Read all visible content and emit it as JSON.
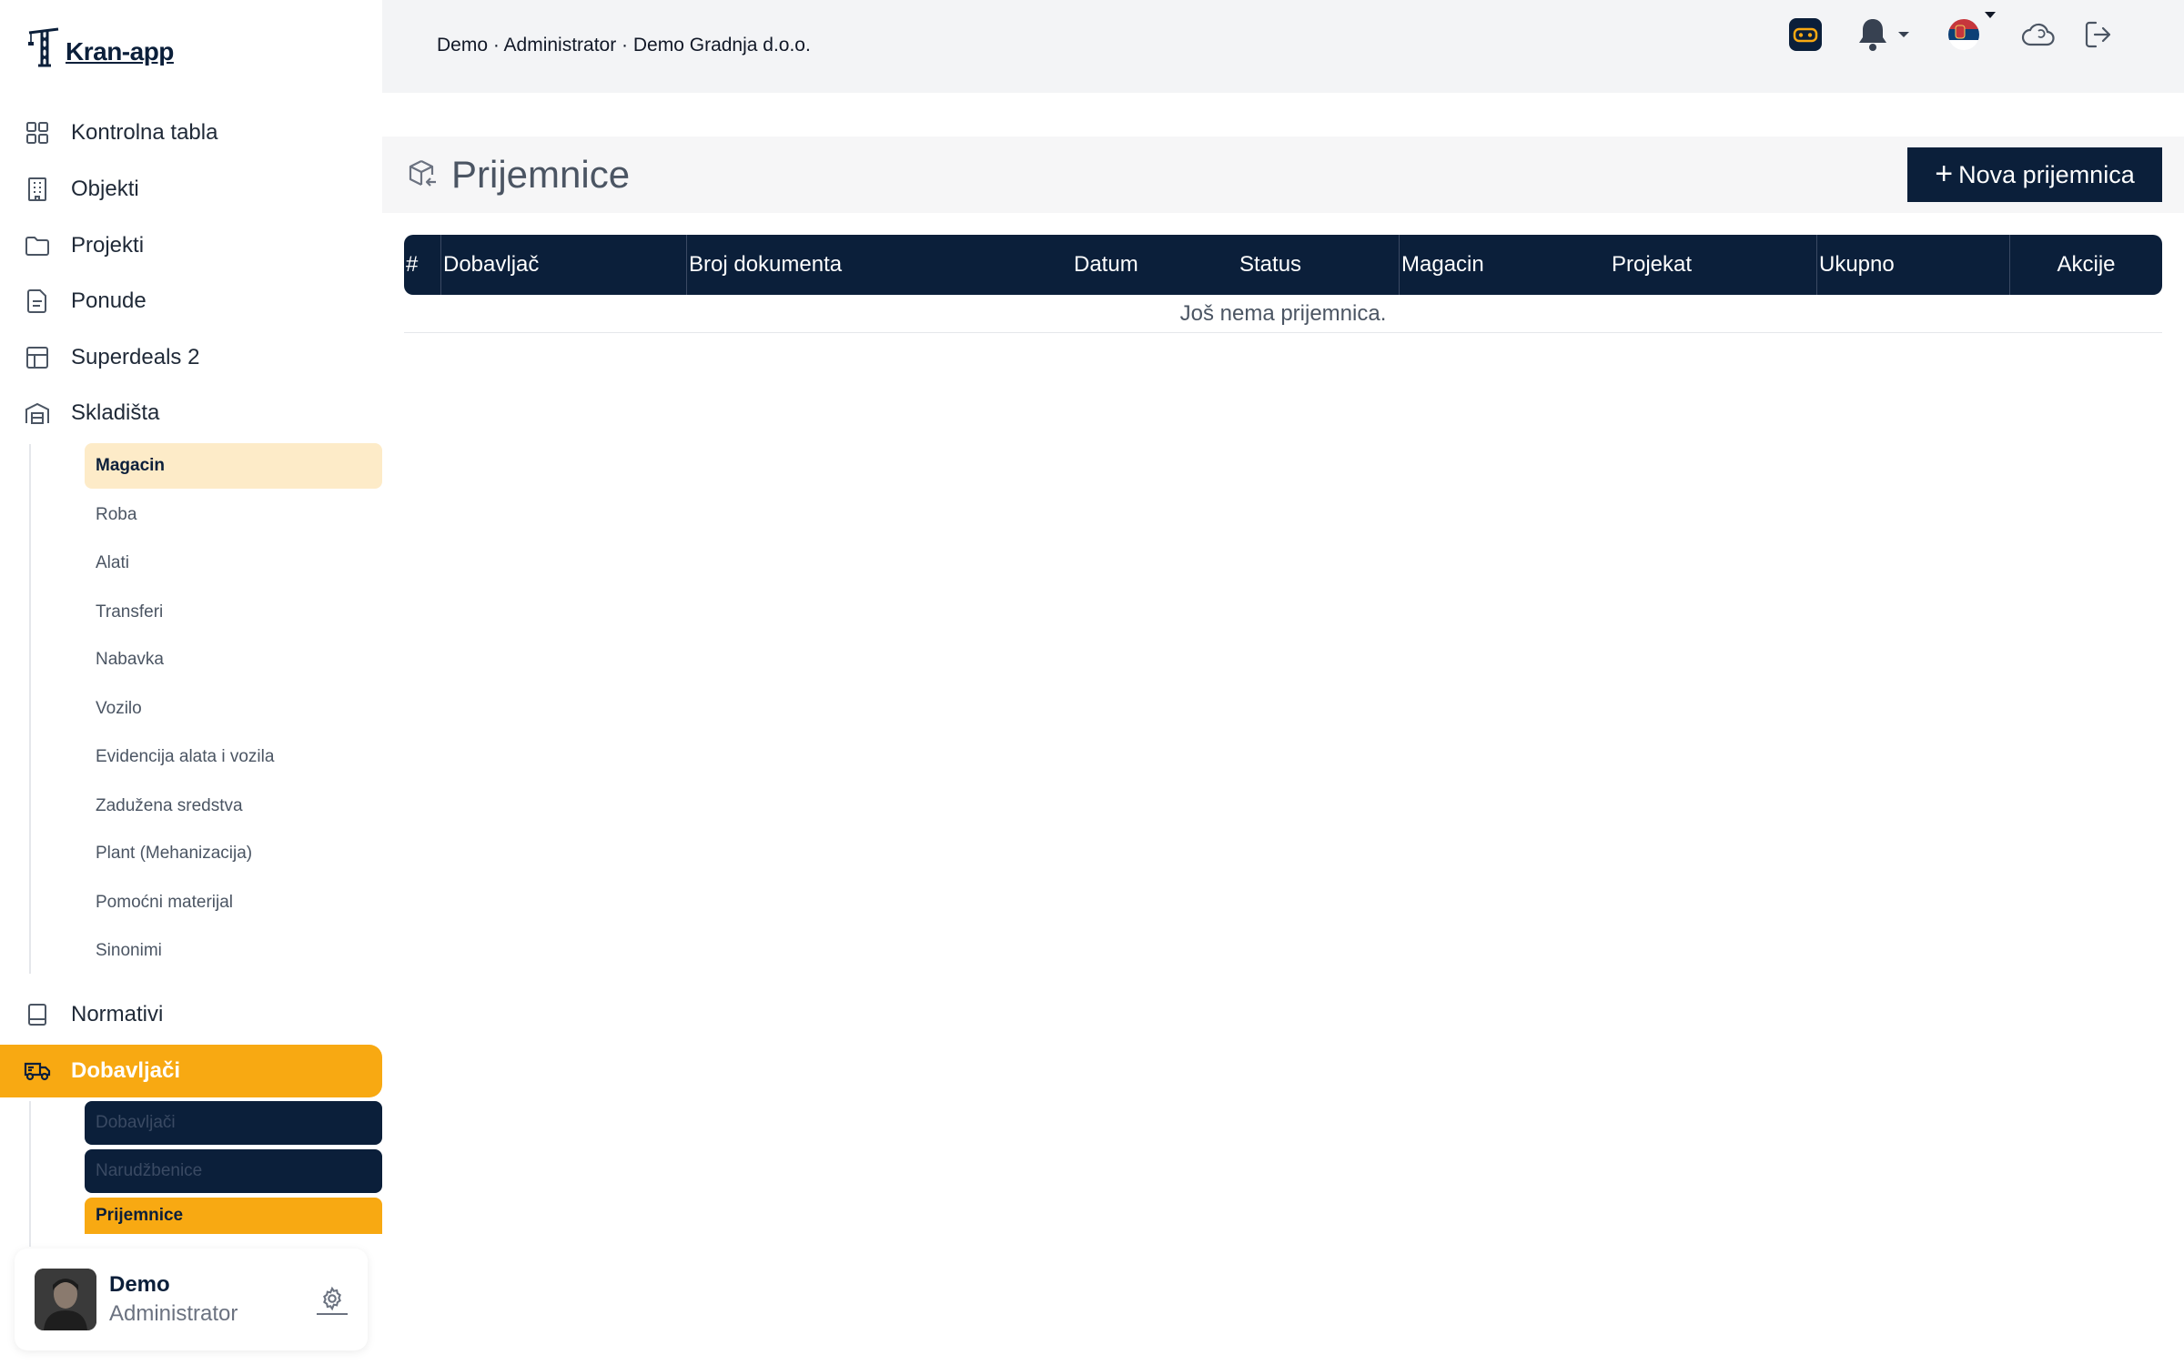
{
  "app": {
    "logo_text": "Kran-app"
  },
  "sidebar": {
    "nav": [
      {
        "label": "Kontrolna tabla",
        "icon": "dashboard-grid-icon"
      },
      {
        "label": "Objekti",
        "icon": "building-icon"
      },
      {
        "label": "Projekti",
        "icon": "folder-icon"
      },
      {
        "label": "Ponude",
        "icon": "document-icon"
      },
      {
        "label": "Superdeals 2",
        "icon": "table-icon"
      },
      {
        "label": "Skladišta",
        "icon": "warehouse-icon"
      }
    ],
    "skladista_sub": [
      "Magacin",
      "Roba",
      "Alati",
      "Transferi",
      "Nabavka",
      "Vozilo",
      "Evidencija alata i vozila",
      "Zadužena sredstva",
      "Plant (Mehanizacija)",
      "Pomoćni materijal",
      "Sinonimi"
    ],
    "nav2": [
      {
        "label": "Normativi",
        "icon": "book-icon"
      },
      {
        "label": "Dobavljači",
        "icon": "truck-icon"
      }
    ],
    "dobavljaci_sub": [
      "Dobavljači",
      "Narudžbenice",
      "Prijemnice"
    ],
    "active_color": "#f8a912"
  },
  "topbar": {
    "breadcrumb": "Demo · Administrator · Demo Gradnja d.o.o."
  },
  "page": {
    "title": "Prijemnice",
    "new_button": "Nova prijemnica",
    "plus": "+"
  },
  "table": {
    "columns": [
      "#",
      "Dobavljač",
      "Broj dokumenta",
      "Datum",
      "Status",
      "Magacin",
      "Projekat",
      "Ukupno",
      "Akcije"
    ],
    "empty_message": "Još nema prijemnica."
  },
  "user": {
    "name": "Demo",
    "role": "Administrator"
  },
  "colors": {
    "navy": "#0b1f3a",
    "accent": "#f8a912"
  }
}
